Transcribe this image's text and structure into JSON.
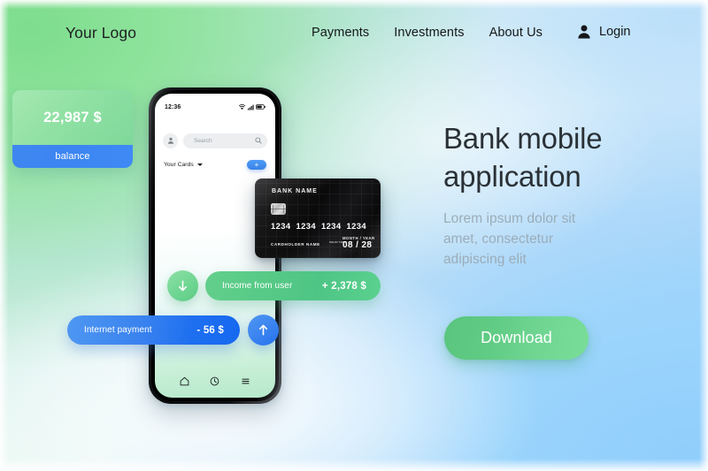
{
  "header": {
    "logo": "Your Logo",
    "nav": [
      {
        "label": "Payments"
      },
      {
        "label": "Investments"
      },
      {
        "label": "About Us"
      }
    ],
    "login": {
      "label": "Login",
      "icon": "user-icon"
    }
  },
  "hero": {
    "title": "Bank mobile application",
    "subtitle": "Lorem ipsum dolor sit amet, consectetur adipiscing elit",
    "cta": "Download"
  },
  "phone": {
    "status": {
      "time": "12:36",
      "icons": [
        "wifi-icon",
        "signal-icon",
        "battery-icon"
      ]
    },
    "search": {
      "placeholder": "Search",
      "avatar_icon": "user-icon",
      "search_icon": "search-icon"
    },
    "cards_row": {
      "label": "Your Cards",
      "caret_icon": "chevron-down-icon",
      "add_label": "+"
    },
    "balance": {
      "amount": "22,987 $",
      "label": "balance"
    },
    "bottom_nav": [
      {
        "icon": "home-icon"
      },
      {
        "icon": "clock-icon"
      },
      {
        "icon": "menu-icon"
      }
    ]
  },
  "credit_card": {
    "bank_name": "BANK  NAME",
    "number": [
      "1234",
      "1234",
      "1234",
      "1234"
    ],
    "holder_label": "CARDHOLDER NAME",
    "valid_thru": "VALID THRU",
    "month_year_label": "MONTH / YEAR",
    "expiry": "08 / 28"
  },
  "transactions": [
    {
      "label": "Income from user",
      "amount": "+ 2,378 $",
      "direction": "in",
      "icon": "arrow-down-icon"
    },
    {
      "label": "Internet payment",
      "amount": "- 56 $",
      "direction": "out",
      "icon": "arrow-up-icon"
    }
  ],
  "colors": {
    "green": "#5ccd86",
    "blue": "#3a83ef",
    "bg_green": "#9ce6a6",
    "bg_blue": "#96cffb",
    "text_dark": "#2a3136",
    "text_muted": "#9bacb8"
  }
}
